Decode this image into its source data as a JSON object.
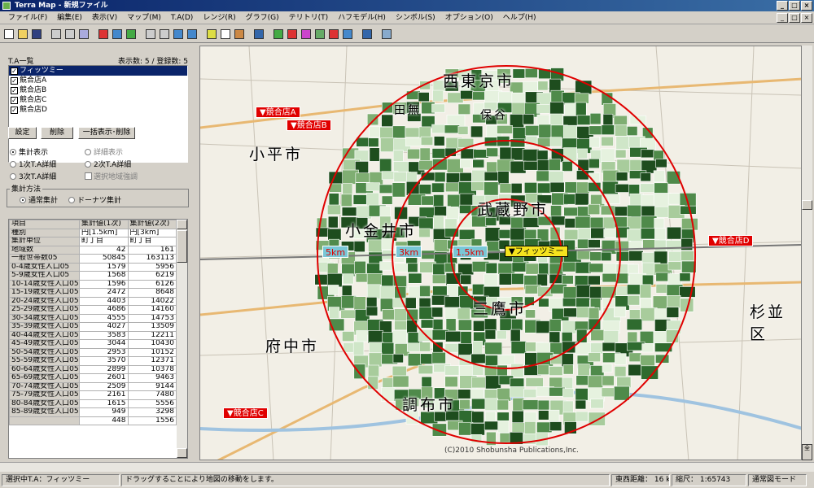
{
  "window": {
    "title": "Terra Map - 新規ファイル"
  },
  "menu": [
    "ファイル(F)",
    "編集(E)",
    "表示(V)",
    "マップ(M)",
    "T.A(D)",
    "レンジ(R)",
    "グラフ(G)",
    "テリトリ(T)",
    "ハフモデル(H)",
    "シンボル(S)",
    "オプション(O)",
    "ヘルプ(H)"
  ],
  "panel": {
    "title": "T.A一覧",
    "count": "表示数: 5 / 登録数: 5",
    "ta_items": [
      "フィッツミー",
      "競合店A",
      "競合店B",
      "競合店C",
      "競合店D"
    ],
    "buttons": {
      "settings": "設定",
      "delete": "削除",
      "bulk": "一括表示･削除"
    },
    "radios": {
      "summary": "集計表示",
      "detail": "詳細表示",
      "ta1": "1次T.A詳細",
      "ta2": "2次T.A詳細",
      "ta3": "3次T.A詳細",
      "select_area": "選択地域強調"
    },
    "method_title": "集計方法",
    "method": {
      "normal": "通常集計",
      "donut": "ドーナツ集計"
    }
  },
  "table": {
    "headers": [
      "項目",
      "集計値(1次)",
      "集計値(2次)"
    ],
    "meta": [
      [
        "種別",
        "円[1.5km]",
        "円[3km]"
      ],
      [
        "集計単位",
        "町丁目",
        "町丁目"
      ]
    ],
    "rows": [
      [
        "地域数",
        "42",
        "161"
      ],
      [
        "一般世帯数05",
        "50845",
        "163113"
      ],
      [
        "0-4歳女性人口05",
        "1579",
        "5956"
      ],
      [
        "5-9歳女性人口05",
        "1568",
        "6219"
      ],
      [
        "10-14歳女性人口05",
        "1596",
        "6126"
      ],
      [
        "15-19歳女性人口05",
        "2472",
        "8648"
      ],
      [
        "20-24歳女性人口05",
        "4403",
        "14022"
      ],
      [
        "25-29歳女性人口05",
        "4686",
        "14160"
      ],
      [
        "30-34歳女性人口05",
        "4555",
        "14753"
      ],
      [
        "35-39歳女性人口05",
        "4027",
        "13509"
      ],
      [
        "40-44歳女性人口05",
        "3583",
        "12211"
      ],
      [
        "45-49歳女性人口05",
        "3044",
        "10430"
      ],
      [
        "50-54歳女性人口05",
        "2953",
        "10152"
      ],
      [
        "55-59歳女性人口05",
        "3570",
        "12371"
      ],
      [
        "60-64歳女性人口05",
        "2899",
        "10378"
      ],
      [
        "65-69歳女性人口05",
        "2601",
        "9463"
      ],
      [
        "70-74歳女性人口05",
        "2509",
        "9144"
      ],
      [
        "75-79歳女性人口05",
        "2161",
        "7480"
      ],
      [
        "80-84歳女性人口05",
        "1615",
        "5556"
      ],
      [
        "85-89歳女性人口05",
        "949",
        "3298"
      ],
      [
        "",
        "448",
        "1556"
      ]
    ]
  },
  "map": {
    "cities": [
      "西東京市",
      "小平市",
      "小金井市",
      "武蔵野市",
      "三鷹市",
      "府中市",
      "調布市",
      "杉並区",
      "田無",
      "保谷"
    ],
    "stores": [
      "競合店A",
      "競合店B",
      "競合店C",
      "競合店D"
    ],
    "rings": [
      "5km",
      "3km",
      "1.5km"
    ],
    "center": "フィッツミー",
    "copyright": "(C)2010 Shobunsha Publications,Inc.",
    "zoom_all": "全"
  },
  "status": {
    "selected": "選択中T.A：フィッツミー",
    "hint": "ドラッグすることにより地図の移動をします。",
    "distance": "東西距離： 16 km",
    "scale": "縮尺： 1:65743",
    "mode": "通常図モード"
  },
  "colors": {
    "title_bar": "#0a246a",
    "ring": "#e00000",
    "store": "#e00000",
    "ring_label": "#79c7d6",
    "center": "#f5e31e",
    "choropleth_dark": "#1e4d1e",
    "choropleth_light": "#cfe6c8"
  }
}
